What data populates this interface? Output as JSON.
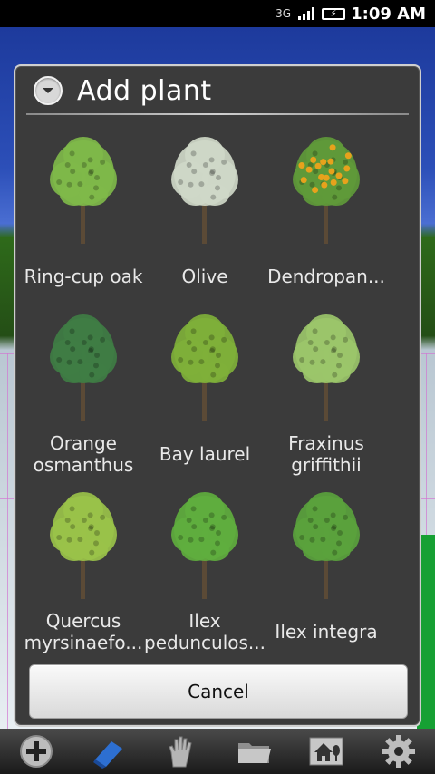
{
  "status_bar": {
    "network_label": "3G",
    "time": "1:09 AM"
  },
  "dialog": {
    "title": "Add plant",
    "plants": [
      {
        "label": "Ring-cup oak",
        "foliage": "#7fb84a",
        "accent": ""
      },
      {
        "label": "Olive",
        "foliage": "#cfd8c8",
        "accent": ""
      },
      {
        "label": "Dendropan...",
        "foliage": "#5f9a3a",
        "accent": "#e7a21c"
      },
      {
        "label": "Orange osmanthus",
        "foliage": "#3f7d44",
        "accent": ""
      },
      {
        "label": "Bay laurel",
        "foliage": "#7fb03a",
        "accent": ""
      },
      {
        "label": "Fraxinus griffithii",
        "foliage": "#9bc56a",
        "accent": ""
      },
      {
        "label": "Quercus myrsinaefo...",
        "foliage": "#9ac24a",
        "accent": ""
      },
      {
        "label": "Ilex pedunculos...",
        "foliage": "#5fae3e",
        "accent": ""
      },
      {
        "label": "Ilex integra",
        "foliage": "#5aa23d",
        "accent": ""
      }
    ],
    "cancel_label": "Cancel"
  },
  "toolbar": {
    "items": [
      {
        "icon": "add-icon"
      },
      {
        "icon": "eraser-icon"
      },
      {
        "icon": "hand-icon"
      },
      {
        "icon": "folder-icon"
      },
      {
        "icon": "house-tree-icon"
      },
      {
        "icon": "gear-icon"
      }
    ]
  },
  "colors": {
    "dialog_bg": "#3b3b3b",
    "accent_blue": "#2d6fd1"
  }
}
